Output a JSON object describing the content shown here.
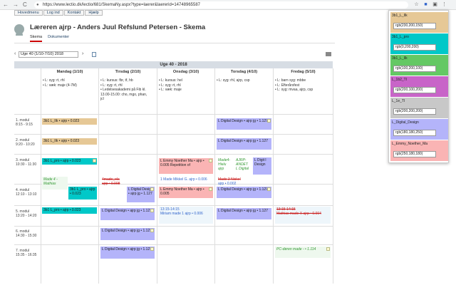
{
  "browser": {
    "url": "https://www.lectio.dk/lectio/681/SkemaNy.aspx?type=laerer&laererid=14748965587",
    "back": "←",
    "forward": "→",
    "reload": "C"
  },
  "top_links": [
    "Hovedmenu",
    "Log ind",
    "Kontakt",
    "Hjælp"
  ],
  "page_title": "Læreren ajrp - Anders Juul Refslund Petersen - Skema",
  "tabs": [
    "Skema",
    "Dokumenter"
  ],
  "week_select": "Uge 40 (1/10-7/10) 2018",
  "week_header": "Uge 40 - 2018",
  "days": [
    "Mandag (1/10)",
    "Tirsdag (2/10)",
    "Onsdag (3/10)",
    "Torsdag (4/10)",
    "Fredag (5/10)"
  ],
  "notes": {
    "mon": [
      "• L: syg: rt, rhl",
      "• L: væk: maje (4-7M)"
    ],
    "tue": [
      "• L: kursus: fbr, tf, hb",
      "• L: syg: rt, rhl",
      "• Ledelsesakademi på Fib kl.",
      "  13.00-15.00: cho, mgo, phan,",
      "  jcl"
    ],
    "wed": [
      "• L: kursus: hel",
      "• L: syg: rt, rhl",
      "• L: væk: maje"
    ],
    "thu": [
      "• L: syg: rhl, ajrp, csp"
    ],
    "fri": [
      "• L: barn syg: mbbe",
      "• L: Efterårsfest",
      "• L: syg: mvaa, ajrp, csp"
    ]
  },
  "modules": [
    {
      "name": "1. modul",
      "time": "8:15 - 9:15"
    },
    {
      "name": "2. modul",
      "time": "9:20 - 10:20"
    },
    {
      "name": "3. modul",
      "time": "10:30 - 11:30"
    },
    {
      "name": "4. modul",
      "time": "12:10 - 13:10"
    },
    {
      "name": "5. modul",
      "time": "13:20 - 14:20"
    },
    {
      "name": "6. modul",
      "time": "14:30 - 15:30"
    },
    {
      "name": "7. modul",
      "time": "15:35 - 16:35"
    }
  ],
  "lessons": {
    "mon1": "3b1 L_Ilk • ajrp • 0.023",
    "mon2": "3b1 L_Ilk • ajrp • 0.023",
    "mon3": "3b1 L_pro • ajrp • 0.023",
    "mon4a": "Made 4 - Mathias",
    "mon4b": "3b1 L_pro • ajrp • 0.023",
    "mon5": "3b1 L_pro • ajrp • 0.023",
    "tue4a": "4made_ola ajrp • 0.008",
    "tue4b": "L Digital Design • ajrp jg • 1.127",
    "tue5": "L Digital Design • ajrp jg • 1.127",
    "tue6": "L Digital Design • ajrp jg • 1.127",
    "tue7": "L Digital Design • ajrp jg • 1.127",
    "wed3": "L Emmy Noether Ma • ajrp • 0.005 Repetition of",
    "wed4a": "1 Made Mikkel G. ajrp • 0.006",
    "wed4b": "L Emmy Noether Ma • ajrp • 0.005",
    "wed5a": "13:15-14:15",
    "wed5b": "Miriam made 1 ajrp • 0.006",
    "thu1": "L Digital Design • ajrp jg • 1.127",
    "thu2": "L Digital Design • ajrp jg • 1.127",
    "thu3a": "Made4-Hielu ajrp",
    "thu3b": "AJRP-ANDET L Digital",
    "thu3c": "L Digit l Design",
    "thu4a": "Made 3 Nickel",
    "thu4b": "ajrp • 0.002",
    "thu4c": "L Digital Design • ajrp jg • 1.127",
    "thu5": "L Digital Design • ajrp jg • 1.127",
    "fri5a": "13:15-14:15",
    "fri5b": "Mathias made X ajrp • 0.004",
    "fri7": "PC-døren made - • 1.114"
  },
  "popup": [
    {
      "label": "3b1_L_Ilk",
      "value": "rgb(230,200,150)",
      "color": "#e6c896"
    },
    {
      "label": "3b1_L_pro",
      "value": "rgb(0,200,200)",
      "color": "#00c8c8"
    },
    {
      "label": "3b1_L_Ilk",
      "value": "rgb(100,200,100)",
      "color": "#64c864"
    },
    {
      "label": "L_1b2_TI",
      "value": "rgb(200,100,200)",
      "color": "#c864c8"
    },
    {
      "label": "L_1e_TI",
      "value": "rgb(200,200,200)",
      "color": "#c8c8c8"
    },
    {
      "label": "L_Digital_Design",
      "value": "rgb(180,180,250)",
      "color": "#b4b4fa"
    },
    {
      "label": "L_Emmy_Noether_Ma",
      "value": "rgb(250,180,180)",
      "color": "#fab4b4"
    }
  ],
  "colors": {
    "ilk": "#e6c896",
    "pro": "#00c8c8",
    "digital": "#b4b4fa",
    "emmy": "#fab4b4",
    "header": "#d7dde4"
  }
}
